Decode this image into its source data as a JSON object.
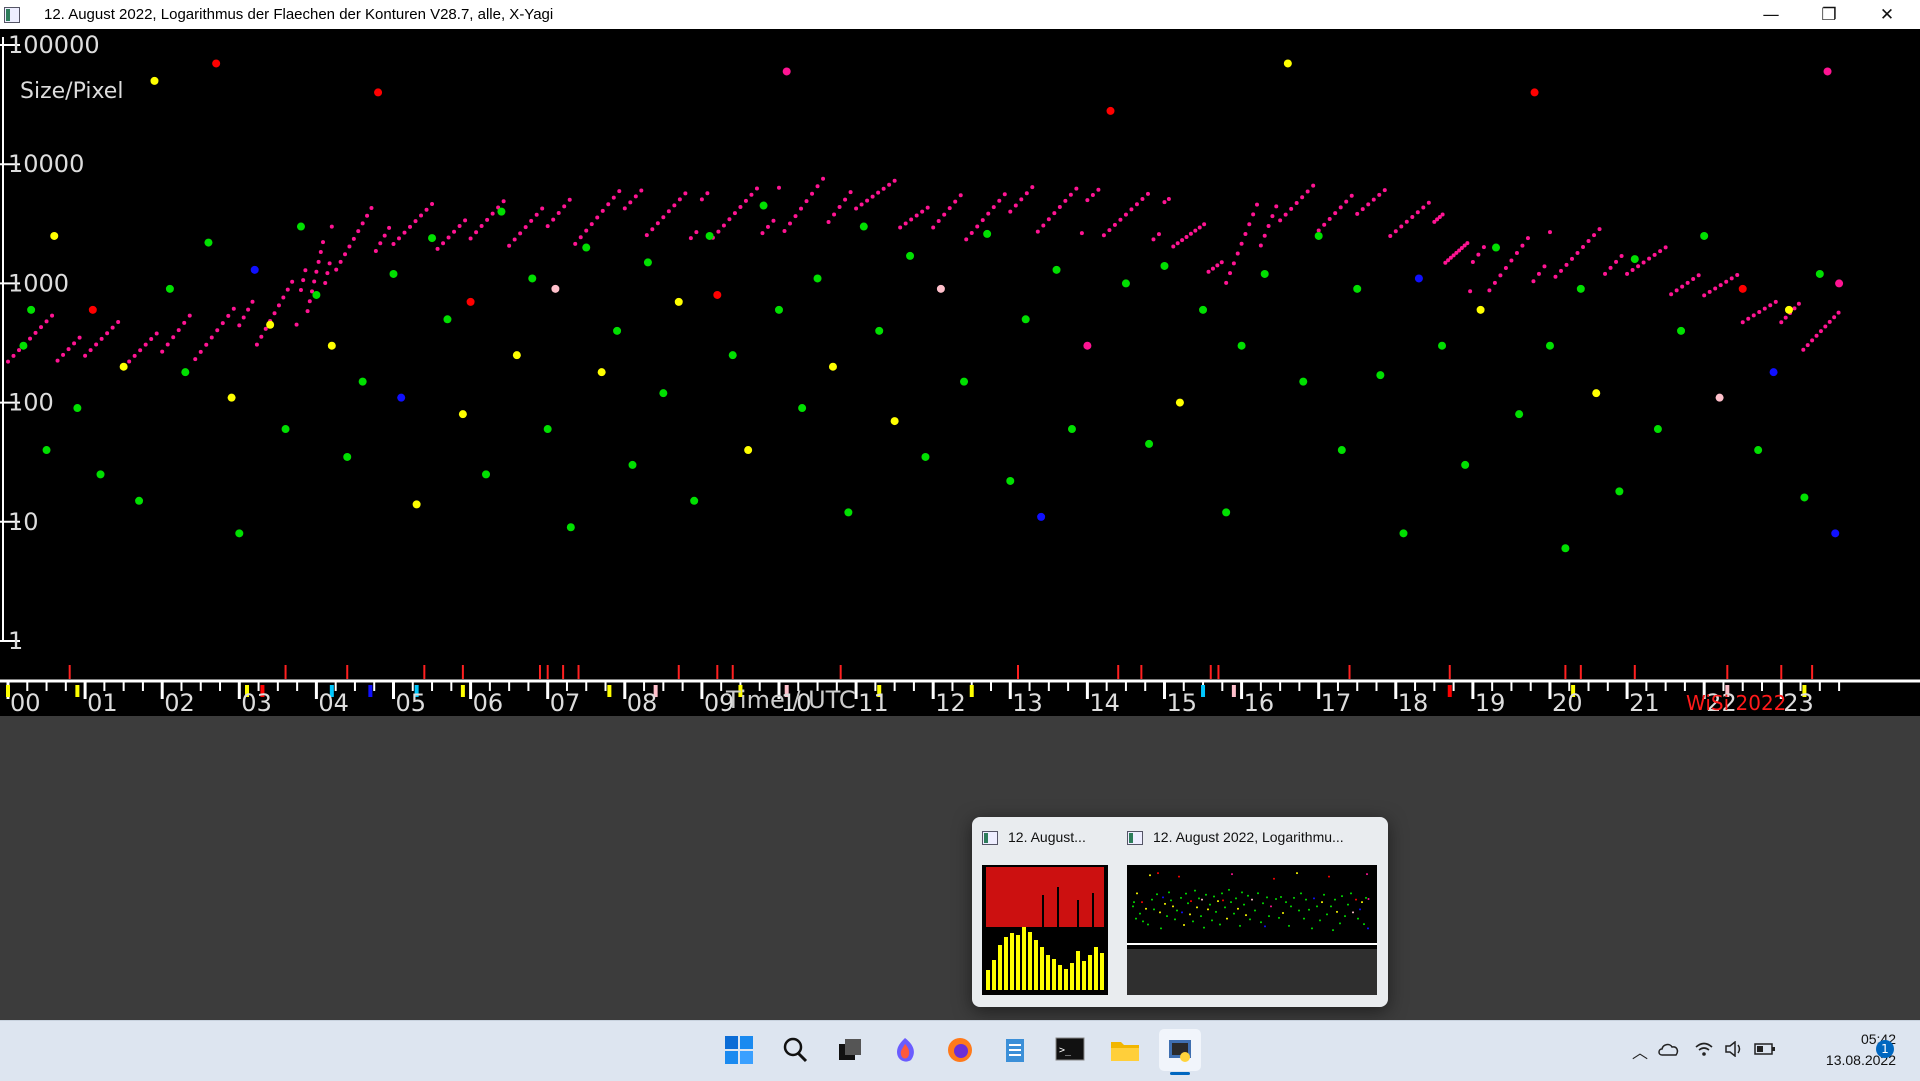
{
  "window": {
    "title": "12. August 2022, Logarithmus der Flaechen der Konturen V28.7, alle, X-Yagi",
    "minimize_symbol": "—",
    "restore_symbol": "❐",
    "close_symbol": "✕"
  },
  "chart_data": {
    "type": "scatter",
    "y_scale": "log",
    "ylim": [
      1,
      100000
    ],
    "xlim": [
      0,
      24
    ],
    "y_tick_labels": [
      "100000",
      "10000",
      "1000",
      "100",
      "10",
      "1"
    ],
    "y_ticks": [
      100000,
      10000,
      1000,
      100,
      10,
      1
    ],
    "ylabel": "Size/Pixel",
    "xlabel": "Time / UTC",
    "x_tick_labels": [
      "00",
      "01",
      "02",
      "03",
      "04",
      "05",
      "06",
      "07",
      "08",
      "09",
      "10",
      "11",
      "12",
      "13",
      "14",
      "15",
      "16",
      "17",
      "18",
      "19",
      "20",
      "21",
      "22",
      "23"
    ],
    "watermark": "WiSi 2022",
    "background": "#000000",
    "series_colors": {
      "green": "#00e000",
      "yellow": "#ffff00",
      "red": "#ff0000",
      "blue": "#1010ff",
      "magenta": "#ff1493",
      "pink": "#ffc0cb"
    },
    "background_band": [
      {
        "x": 0,
        "y": 350
      },
      {
        "x": 1,
        "y": 330
      },
      {
        "x": 2,
        "y": 300
      },
      {
        "x": 3,
        "y": 420
      },
      {
        "x": 3.8,
        "y": 700
      },
      {
        "x": 4.2,
        "y": 2000
      },
      {
        "x": 5,
        "y": 3200
      },
      {
        "x": 6,
        "y": 3000
      },
      {
        "x": 7,
        "y": 3200
      },
      {
        "x": 8,
        "y": 3800
      },
      {
        "x": 9,
        "y": 3800
      },
      {
        "x": 10,
        "y": 4000
      },
      {
        "x": 11,
        "y": 6000
      },
      {
        "x": 12,
        "y": 3500
      },
      {
        "x": 13,
        "y": 4000
      },
      {
        "x": 14,
        "y": 4200
      },
      {
        "x": 15,
        "y": 3400
      },
      {
        "x": 15.8,
        "y": 1600
      },
      {
        "x": 16.5,
        "y": 4500
      },
      {
        "x": 17.5,
        "y": 4300
      },
      {
        "x": 18.5,
        "y": 3100
      },
      {
        "x": 19,
        "y": 1200
      },
      {
        "x": 20,
        "y": 1800
      },
      {
        "x": 21,
        "y": 1800
      },
      {
        "x": 22,
        "y": 1000
      },
      {
        "x": 23,
        "y": 500
      },
      {
        "x": 23.8,
        "y": 350
      }
    ],
    "points": [
      {
        "x": 0.2,
        "y": 300,
        "c": "green"
      },
      {
        "x": 0.3,
        "y": 600,
        "c": "green"
      },
      {
        "x": 0.5,
        "y": 40,
        "c": "green"
      },
      {
        "x": 0.6,
        "y": 2500,
        "c": "yellow"
      },
      {
        "x": 0.9,
        "y": 90,
        "c": "green"
      },
      {
        "x": 1.1,
        "y": 600,
        "c": "red"
      },
      {
        "x": 1.2,
        "y": 25,
        "c": "green"
      },
      {
        "x": 1.5,
        "y": 200,
        "c": "yellow"
      },
      {
        "x": 1.7,
        "y": 15,
        "c": "green"
      },
      {
        "x": 1.9,
        "y": 50000,
        "c": "yellow"
      },
      {
        "x": 2.1,
        "y": 900,
        "c": "green"
      },
      {
        "x": 2.3,
        "y": 180,
        "c": "green"
      },
      {
        "x": 2.6,
        "y": 2200,
        "c": "green"
      },
      {
        "x": 2.7,
        "y": 70000,
        "c": "red"
      },
      {
        "x": 2.9,
        "y": 110,
        "c": "yellow"
      },
      {
        "x": 3.0,
        "y": 8,
        "c": "green"
      },
      {
        "x": 3.2,
        "y": 1300,
        "c": "blue"
      },
      {
        "x": 3.4,
        "y": 450,
        "c": "yellow"
      },
      {
        "x": 3.6,
        "y": 60,
        "c": "green"
      },
      {
        "x": 3.8,
        "y": 3000,
        "c": "green"
      },
      {
        "x": 4.0,
        "y": 800,
        "c": "green"
      },
      {
        "x": 4.2,
        "y": 300,
        "c": "yellow"
      },
      {
        "x": 4.4,
        "y": 35,
        "c": "green"
      },
      {
        "x": 4.6,
        "y": 150,
        "c": "green"
      },
      {
        "x": 4.8,
        "y": 40000,
        "c": "red"
      },
      {
        "x": 5.0,
        "y": 1200,
        "c": "green"
      },
      {
        "x": 5.1,
        "y": 110,
        "c": "blue"
      },
      {
        "x": 5.3,
        "y": 14,
        "c": "yellow"
      },
      {
        "x": 5.5,
        "y": 2400,
        "c": "green"
      },
      {
        "x": 5.7,
        "y": 500,
        "c": "green"
      },
      {
        "x": 5.9,
        "y": 80,
        "c": "yellow"
      },
      {
        "x": 6.0,
        "y": 700,
        "c": "red"
      },
      {
        "x": 6.2,
        "y": 25,
        "c": "green"
      },
      {
        "x": 6.4,
        "y": 4000,
        "c": "green"
      },
      {
        "x": 6.6,
        "y": 250,
        "c": "yellow"
      },
      {
        "x": 6.8,
        "y": 1100,
        "c": "green"
      },
      {
        "x": 7.0,
        "y": 60,
        "c": "green"
      },
      {
        "x": 7.1,
        "y": 900,
        "c": "pink"
      },
      {
        "x": 7.3,
        "y": 9,
        "c": "green"
      },
      {
        "x": 7.5,
        "y": 2000,
        "c": "green"
      },
      {
        "x": 7.7,
        "y": 180,
        "c": "yellow"
      },
      {
        "x": 7.9,
        "y": 400,
        "c": "green"
      },
      {
        "x": 8.1,
        "y": 30,
        "c": "green"
      },
      {
        "x": 8.3,
        "y": 1500,
        "c": "green"
      },
      {
        "x": 8.5,
        "y": 120,
        "c": "green"
      },
      {
        "x": 8.7,
        "y": 700,
        "c": "yellow"
      },
      {
        "x": 8.9,
        "y": 15,
        "c": "green"
      },
      {
        "x": 9.1,
        "y": 2500,
        "c": "green"
      },
      {
        "x": 9.2,
        "y": 800,
        "c": "red"
      },
      {
        "x": 9.4,
        "y": 250,
        "c": "green"
      },
      {
        "x": 9.6,
        "y": 40,
        "c": "yellow"
      },
      {
        "x": 9.8,
        "y": 4500,
        "c": "green"
      },
      {
        "x": 10.0,
        "y": 600,
        "c": "green"
      },
      {
        "x": 10.1,
        "y": 60000,
        "c": "magenta"
      },
      {
        "x": 10.3,
        "y": 90,
        "c": "green"
      },
      {
        "x": 10.5,
        "y": 1100,
        "c": "green"
      },
      {
        "x": 10.7,
        "y": 200,
        "c": "yellow"
      },
      {
        "x": 10.9,
        "y": 12,
        "c": "green"
      },
      {
        "x": 11.1,
        "y": 3000,
        "c": "green"
      },
      {
        "x": 11.3,
        "y": 400,
        "c": "green"
      },
      {
        "x": 11.5,
        "y": 70,
        "c": "yellow"
      },
      {
        "x": 11.7,
        "y": 1700,
        "c": "green"
      },
      {
        "x": 11.9,
        "y": 35,
        "c": "green"
      },
      {
        "x": 12.1,
        "y": 900,
        "c": "pink"
      },
      {
        "x": 12.4,
        "y": 150,
        "c": "green"
      },
      {
        "x": 12.7,
        "y": 2600,
        "c": "green"
      },
      {
        "x": 13.0,
        "y": 22,
        "c": "green"
      },
      {
        "x": 13.2,
        "y": 500,
        "c": "green"
      },
      {
        "x": 13.4,
        "y": 11,
        "c": "blue"
      },
      {
        "x": 13.6,
        "y": 1300,
        "c": "green"
      },
      {
        "x": 13.8,
        "y": 60,
        "c": "green"
      },
      {
        "x": 14.0,
        "y": 300,
        "c": "magenta"
      },
      {
        "x": 14.3,
        "y": 28000,
        "c": "red"
      },
      {
        "x": 14.5,
        "y": 1000,
        "c": "green"
      },
      {
        "x": 14.8,
        "y": 45,
        "c": "green"
      },
      {
        "x": 15.0,
        "y": 1400,
        "c": "green"
      },
      {
        "x": 15.2,
        "y": 100,
        "c": "yellow"
      },
      {
        "x": 15.5,
        "y": 600,
        "c": "green"
      },
      {
        "x": 15.8,
        "y": 12,
        "c": "green"
      },
      {
        "x": 16.0,
        "y": 300,
        "c": "green"
      },
      {
        "x": 16.3,
        "y": 1200,
        "c": "green"
      },
      {
        "x": 16.6,
        "y": 70000,
        "c": "yellow"
      },
      {
        "x": 16.8,
        "y": 150,
        "c": "green"
      },
      {
        "x": 17.0,
        "y": 2500,
        "c": "green"
      },
      {
        "x": 17.3,
        "y": 40,
        "c": "green"
      },
      {
        "x": 17.5,
        "y": 900,
        "c": "green"
      },
      {
        "x": 17.8,
        "y": 170,
        "c": "green"
      },
      {
        "x": 18.1,
        "y": 8,
        "c": "green"
      },
      {
        "x": 18.3,
        "y": 1100,
        "c": "blue"
      },
      {
        "x": 18.6,
        "y": 300,
        "c": "green"
      },
      {
        "x": 18.9,
        "y": 30,
        "c": "green"
      },
      {
        "x": 19.1,
        "y": 600,
        "c": "yellow"
      },
      {
        "x": 19.3,
        "y": 2000,
        "c": "green"
      },
      {
        "x": 19.6,
        "y": 80,
        "c": "green"
      },
      {
        "x": 19.8,
        "y": 40000,
        "c": "red"
      },
      {
        "x": 20.0,
        "y": 300,
        "c": "green"
      },
      {
        "x": 20.2,
        "y": 6,
        "c": "green"
      },
      {
        "x": 20.4,
        "y": 900,
        "c": "green"
      },
      {
        "x": 20.6,
        "y": 120,
        "c": "yellow"
      },
      {
        "x": 20.9,
        "y": 18,
        "c": "green"
      },
      {
        "x": 21.1,
        "y": 1600,
        "c": "green"
      },
      {
        "x": 21.4,
        "y": 60,
        "c": "green"
      },
      {
        "x": 21.7,
        "y": 400,
        "c": "green"
      },
      {
        "x": 22.0,
        "y": 2500,
        "c": "green"
      },
      {
        "x": 22.2,
        "y": 110,
        "c": "pink"
      },
      {
        "x": 22.5,
        "y": 900,
        "c": "red"
      },
      {
        "x": 22.7,
        "y": 40,
        "c": "green"
      },
      {
        "x": 22.9,
        "y": 180,
        "c": "blue"
      },
      {
        "x": 23.1,
        "y": 600,
        "c": "yellow"
      },
      {
        "x": 23.3,
        "y": 16,
        "c": "green"
      },
      {
        "x": 23.5,
        "y": 1200,
        "c": "green"
      },
      {
        "x": 23.6,
        "y": 60000,
        "c": "magenta"
      },
      {
        "x": 23.7,
        "y": 8,
        "c": "blue"
      },
      {
        "x": 23.75,
        "y": 1000,
        "c": "magenta"
      }
    ],
    "event_markers": [
      {
        "x": 0.0,
        "c": "yellow"
      },
      {
        "x": 0.9,
        "c": "yellow"
      },
      {
        "x": 3.1,
        "c": "yellow"
      },
      {
        "x": 3.3,
        "c": "red"
      },
      {
        "x": 4.2,
        "c": "cyan"
      },
      {
        "x": 4.7,
        "c": "blue"
      },
      {
        "x": 5.3,
        "c": "cyan"
      },
      {
        "x": 5.9,
        "c": "yellow"
      },
      {
        "x": 7.8,
        "c": "yellow"
      },
      {
        "x": 8.4,
        "c": "pink"
      },
      {
        "x": 9.5,
        "c": "yellow"
      },
      {
        "x": 10.1,
        "c": "pink"
      },
      {
        "x": 11.3,
        "c": "yellow"
      },
      {
        "x": 12.5,
        "c": "yellow"
      },
      {
        "x": 15.5,
        "c": "cyan"
      },
      {
        "x": 15.9,
        "c": "pink"
      },
      {
        "x": 18.7,
        "c": "red"
      },
      {
        "x": 20.3,
        "c": "yellow"
      },
      {
        "x": 22.3,
        "c": "pink"
      },
      {
        "x": 23.3,
        "c": "yellow"
      }
    ],
    "red_ticks": [
      0.8,
      3.6,
      4.4,
      5.4,
      5.9,
      6.9,
      7.0,
      7.2,
      7.4,
      8.7,
      9.2,
      9.4,
      10.8,
      13.1,
      14.4,
      14.7,
      15.6,
      15.7,
      17.4,
      18.7,
      20.2,
      20.4,
      21.1,
      22.3,
      23.0,
      23.4
    ]
  },
  "preview": {
    "tab1_label": "12. August...",
    "tab2_label": "12. August 2022, Logarithmu..."
  },
  "taskbar": {
    "apps": [
      {
        "name": "start-button",
        "glyph": "⊞"
      },
      {
        "name": "search-button",
        "glyph": "⌕"
      },
      {
        "name": "task-view-button",
        "glyph": "❐"
      },
      {
        "name": "browser-button",
        "glyph": "●"
      },
      {
        "name": "firefox-button",
        "glyph": "●"
      },
      {
        "name": "notepad-button",
        "glyph": "▤"
      },
      {
        "name": "terminal-button",
        "glyph": ">_"
      },
      {
        "name": "file-explorer-button",
        "glyph": "▭"
      },
      {
        "name": "python-app-button",
        "glyph": "▣"
      }
    ],
    "clock_time": "05:42",
    "clock_date": "13.08.2022",
    "notification_count": "1"
  }
}
